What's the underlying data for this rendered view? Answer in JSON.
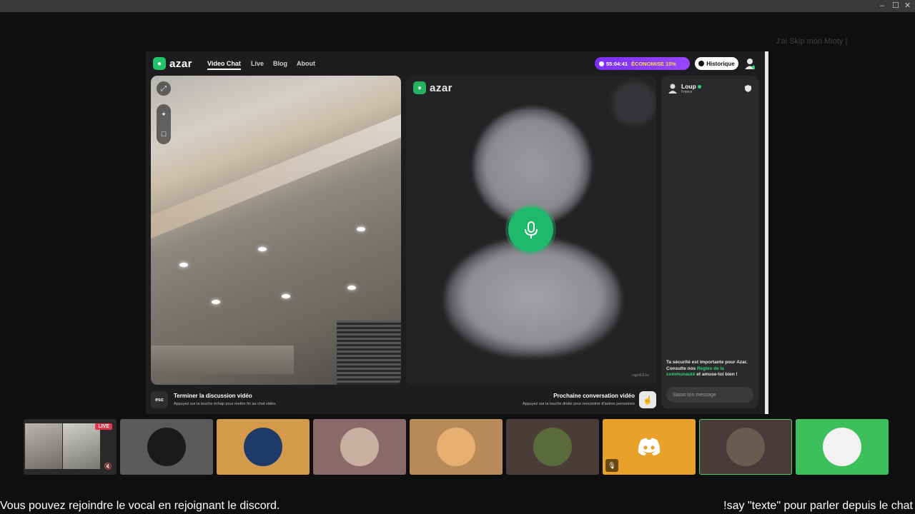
{
  "window": {
    "minimize": "–",
    "maximize": "☐",
    "close": "✕"
  },
  "overlay": {
    "ghost_text": "J'ai Skip mon Mioty |"
  },
  "azar": {
    "logo": "azar",
    "nav": [
      "Video Chat",
      "Live",
      "Blog",
      "About"
    ],
    "timer": "55:04:41",
    "promo": "ÉCONOMISE 15%",
    "history_label": "Historique",
    "self_tools": {
      "expand": "⤢",
      "effects": "✦",
      "filter": "☐"
    },
    "partner_logo": "azar",
    "watermark": "cqpo6JLkz",
    "chat": {
      "user_name": "Loup",
      "country": "France",
      "safety_prefix": "Ta sécurité est importante pour Azar. Consulte nos ",
      "safety_link": "Règles de la communauté",
      "safety_suffix": " et amuse-toi bien !",
      "input_placeholder": "Saisis ton message"
    },
    "bottom": {
      "esc_label": "esc",
      "end_title": "Terminer la discussion vidéo",
      "end_sub": "Appuyez sur la touche échap pour mettre fin au chat vidéo.",
      "next_title": "Prochaine conversation vidéo",
      "next_sub": "Appuyez sur la touche droite pour rencontrer d'autres personnes"
    }
  },
  "tiles": [
    {
      "type": "stream",
      "live": "LIVE",
      "bg": "#2a2a2a"
    },
    {
      "type": "avatar",
      "bg": "#5a5a5a",
      "avatar_bg": "#1a1a1a"
    },
    {
      "type": "avatar",
      "bg": "#d29a4a",
      "avatar_bg": "#1d3a6a"
    },
    {
      "type": "avatar",
      "bg": "#8a6a68",
      "avatar_bg": "#c9b0a0"
    },
    {
      "type": "avatar",
      "bg": "#b88a5a",
      "avatar_bg": "#e8b070"
    },
    {
      "type": "avatar",
      "bg": "#4a3c36",
      "avatar_bg": "#5a6a3a"
    },
    {
      "type": "discord",
      "bg": "#e8a22a"
    },
    {
      "type": "avatar",
      "bg": "#4a3a3a",
      "avatar_bg": "#6a5a50",
      "border": "#4fcf6a"
    },
    {
      "type": "logo",
      "bg": "#3dbf5c",
      "avatar_bg": "#f2f2f2"
    }
  ],
  "captions": {
    "left": "Vous pouvez rejoindre le vocal en rejoignant le discord.",
    "right": "!say \"texte\" pour parler depuis le chat"
  }
}
